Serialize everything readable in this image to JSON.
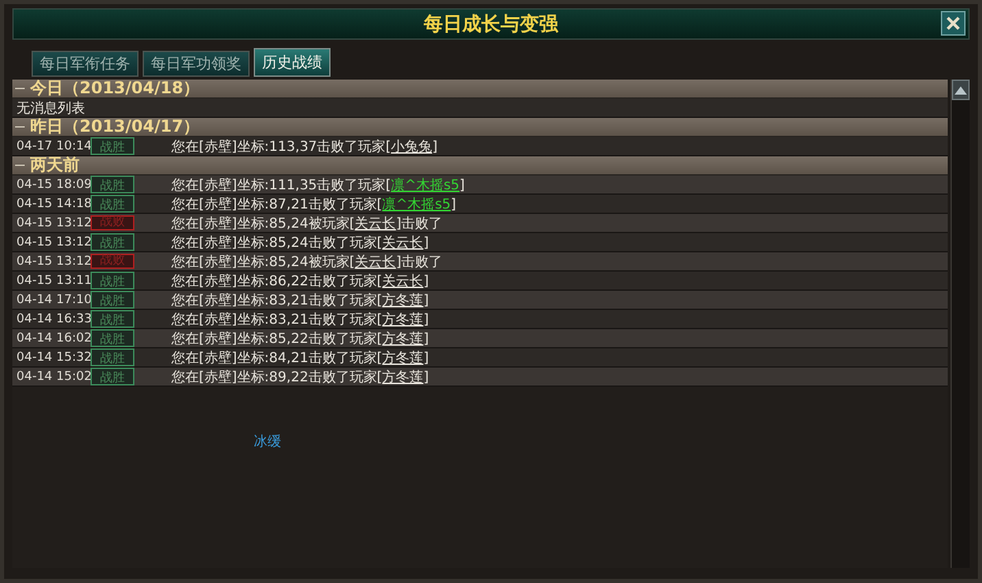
{
  "window": {
    "title": "每日成长与变强"
  },
  "tabs": [
    {
      "label": "每日军衔任务",
      "selected": false
    },
    {
      "label": "每日军功领奖",
      "selected": false
    },
    {
      "label": "历史战绩",
      "selected": true
    }
  ],
  "sections": [
    {
      "title": "今日（2013/04/18）",
      "expanded": true,
      "empty_text": "无消息列表"
    },
    {
      "title": "昨日（2013/04/17）",
      "expanded": true,
      "entries": [
        {
          "time": "04-17 10:14",
          "result": "战胜",
          "kind": "win",
          "before": "您在[赤壁]坐标:113,37击败了玩家[",
          "player": "小兔兔",
          "color": "#e8e4dc",
          "after": "]"
        }
      ]
    },
    {
      "title": "两天前",
      "expanded": true,
      "entries": [
        {
          "time": "04-15 18:09",
          "result": "战胜",
          "kind": "win",
          "before": "您在[赤壁]坐标:111,35击败了玩家[",
          "player": "凛^木摇s5",
          "color": "#33d633",
          "after": "]"
        },
        {
          "time": "04-15 14:18",
          "result": "战胜",
          "kind": "win",
          "before": "您在[赤壁]坐标:87,21击败了玩家[",
          "player": "凛^木摇s5",
          "color": "#33d633",
          "after": "]"
        },
        {
          "time": "04-15 13:12",
          "result": "战败",
          "kind": "lose",
          "before": "您在[赤壁]坐标:85,24被玩家[",
          "player": "关云长",
          "color": "#e8e4dc",
          "after": "]击败了"
        },
        {
          "time": "04-15 13:12",
          "result": "战胜",
          "kind": "win",
          "before": "您在[赤壁]坐标:85,24击败了玩家[",
          "player": "关云长",
          "color": "#e8e4dc",
          "after": "]"
        },
        {
          "time": "04-15 13:12",
          "result": "战败",
          "kind": "lose",
          "before": "您在[赤壁]坐标:85,24被玩家[",
          "player": "关云长",
          "color": "#e8e4dc",
          "after": "]击败了"
        },
        {
          "time": "04-15 13:11",
          "result": "战胜",
          "kind": "win",
          "before": "您在[赤壁]坐标:86,22击败了玩家[",
          "player": "关云长",
          "color": "#e8e4dc",
          "after": "]"
        },
        {
          "time": "04-14 17:10",
          "result": "战胜",
          "kind": "win",
          "before": "您在[赤壁]坐标:83,21击败了玩家[",
          "player": "方冬莲",
          "color": "#e8e4dc",
          "after": "]"
        },
        {
          "time": "04-14 16:33",
          "result": "战胜",
          "kind": "win",
          "before": "您在[赤壁]坐标:83,21击败了玩家[",
          "player": "方冬莲",
          "color": "#e8e4dc",
          "after": "]"
        },
        {
          "time": "04-14 16:02",
          "result": "战胜",
          "kind": "win",
          "before": "您在[赤壁]坐标:85,22击败了玩家[",
          "player": "方冬莲",
          "color": "#e8e4dc",
          "after": "]"
        },
        {
          "time": "04-14 15:32",
          "result": "战胜",
          "kind": "win",
          "before": "您在[赤壁]坐标:84,21击败了玩家[",
          "player": "方冬莲",
          "color": "#e8e4dc",
          "after": "]"
        },
        {
          "time": "04-14 15:02",
          "result": "战胜",
          "kind": "win",
          "before": "您在[赤壁]坐标:89,22击败了玩家[",
          "player": "方冬莲",
          "color": "#e8e4dc",
          "after": "]"
        }
      ]
    }
  ],
  "footer_label": "冰缓"
}
